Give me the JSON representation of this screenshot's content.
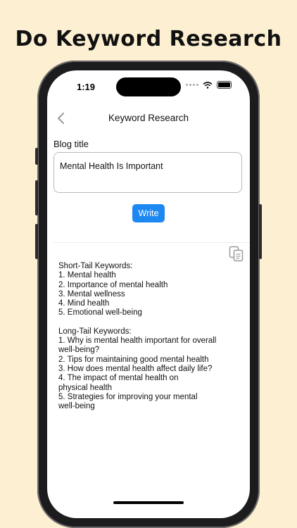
{
  "headline": "Do Keyword Research",
  "status_bar": {
    "time": "1:19"
  },
  "navbar": {
    "title": "Keyword Research"
  },
  "form": {
    "label": "Blog title",
    "value": "Mental Health Is Important",
    "write_label": "Write"
  },
  "output": {
    "short_tail_heading": "Short-Tail Keywords:",
    "short_tail": [
      "1. Mental health",
      "2. Importance of mental health",
      "3. Mental wellness",
      "4. Mind health",
      "5. Emotional well-being"
    ],
    "long_tail_heading": "Long-Tail Keywords:",
    "long_tail": [
      "1. Why is mental health important for overall",
      "well-being?",
      "2. Tips for maintaining good mental health",
      "3. How does mental health affect daily life?",
      "4. The impact of mental health on",
      "physical health",
      "5. Strategies for improving your mental",
      "well-being"
    ]
  },
  "icons": {
    "back": "chevron-left-icon",
    "copy": "copy-icon",
    "wifi": "wifi-icon",
    "battery": "battery-icon"
  },
  "colors": {
    "background": "#fdf0d2",
    "accent": "#1e88f2"
  }
}
